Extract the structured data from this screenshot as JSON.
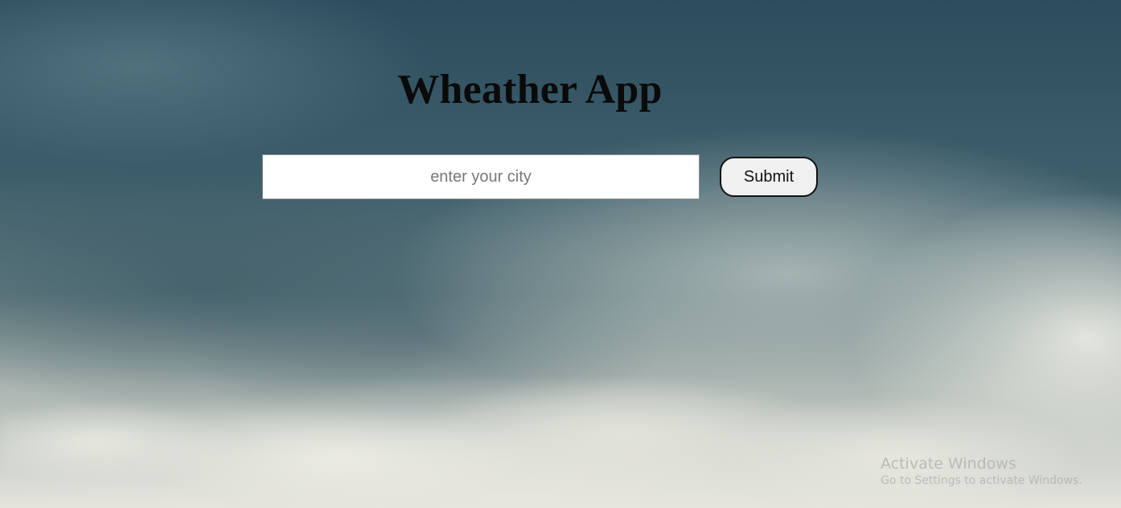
{
  "app": {
    "title": "Wheather App"
  },
  "search": {
    "placeholder": "enter your city",
    "value": ""
  },
  "actions": {
    "submit_label": "Submit"
  },
  "watermark": {
    "title": "Activate Windows",
    "subtitle": "Go to Settings to activate Windows."
  },
  "colors": {
    "title_text": "#0a0a0a",
    "input_background": "#ffffff",
    "button_background": "#f0f0f0",
    "button_border": "#111111",
    "watermark_text": "#aaaaaa"
  }
}
